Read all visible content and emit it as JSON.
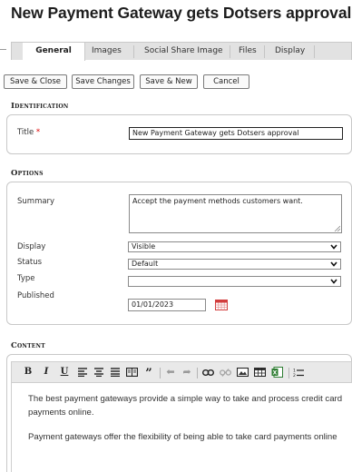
{
  "page": {
    "title": "New Payment Gateway gets Dotsers approval"
  },
  "tabs": [
    {
      "label": "General",
      "active": true
    },
    {
      "label": "Images"
    },
    {
      "label": "Social Share Image"
    },
    {
      "label": "Files"
    },
    {
      "label": "Display"
    }
  ],
  "toolbar": {
    "save_close": "Save & Close",
    "save_changes": "Save Changes",
    "save_new": "Save & New",
    "cancel": "Cancel"
  },
  "identification": {
    "heading": "Identification",
    "title_label": "Title",
    "required_mark": "*",
    "title_value": "New Payment Gateway gets Dotsers approval"
  },
  "options": {
    "heading": "Options",
    "summary_label": "Summary",
    "summary_value": "Accept the payment methods customers want.",
    "display_label": "Display",
    "display_value": "Visible",
    "status_label": "Status",
    "status_value": "Default",
    "type_label": "Type",
    "type_value": "",
    "published_label": "Published",
    "published_value": "01/01/2023"
  },
  "content": {
    "heading": "Content",
    "toolbar_icons": [
      "bold-icon",
      "italic-icon",
      "underline-icon",
      "align-left-icon",
      "align-center-icon",
      "justify-icon",
      "image-block-icon",
      "blockquote-icon",
      "undo-icon",
      "redo-icon",
      "link-icon",
      "unlink-icon",
      "image-icon",
      "table-icon",
      "excel-icon",
      "ordered-list-icon"
    ],
    "paragraph1_line1": "The best payment gateways provide a simple way to take and process credit card",
    "paragraph1_line2": "payments online.",
    "paragraph2_line1": "Payment gateways offer the flexibility of being able to take card payments online"
  },
  "colors": {
    "accent_required": "#dd0000",
    "calendar_icon": "#d23c3c",
    "excel_icon": "#2e7d32"
  }
}
